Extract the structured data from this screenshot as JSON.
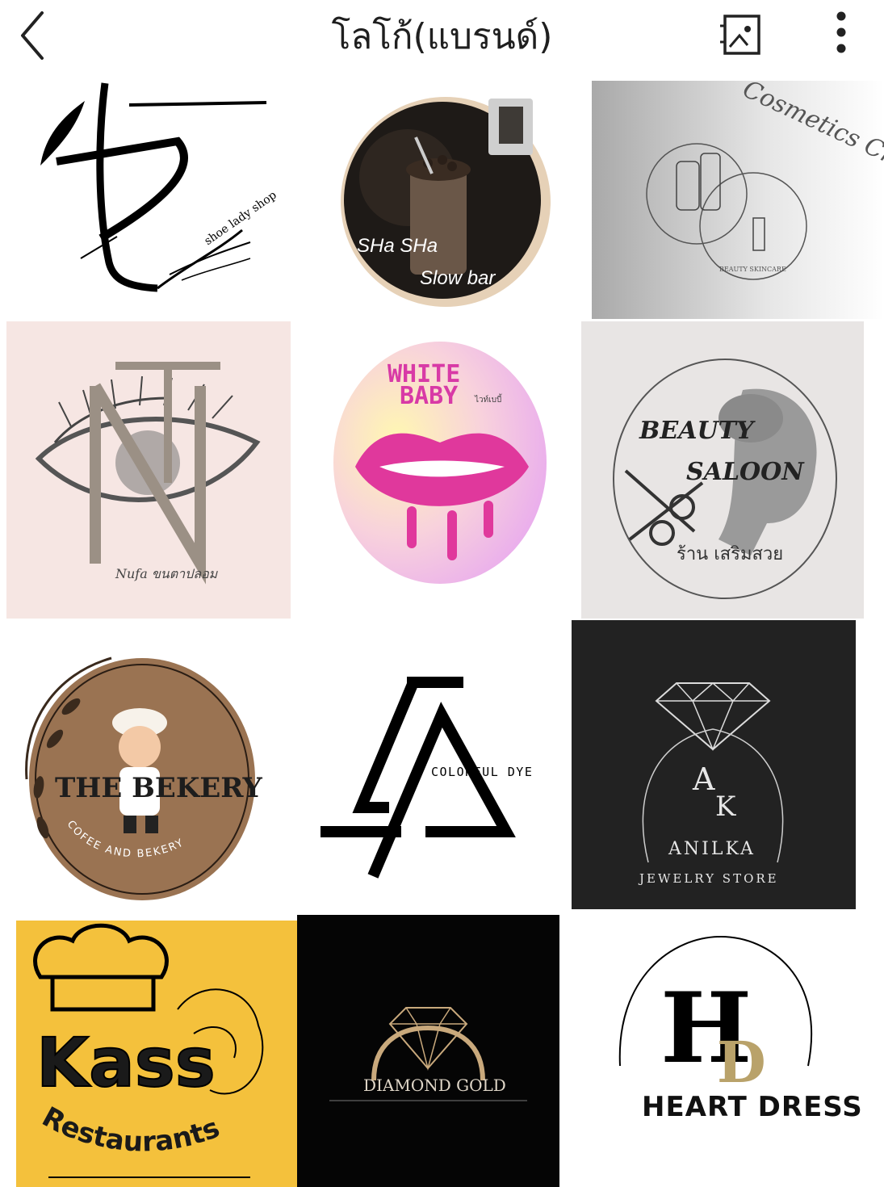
{
  "header": {
    "title": "โลโก้(แบรนด์)",
    "back_icon": "chevron-left-icon",
    "image_icon": "image-frame-icon",
    "more_icon": "more-vertical-icon"
  },
  "gallery": {
    "tiles": [
      {
        "texts": [
          "shoe lady shop"
        ]
      },
      {
        "texts": [
          "SHa SHa",
          "Slow bar"
        ]
      },
      {
        "texts": [
          "Cosmetics Chic",
          "BEAUTY SKINCARE"
        ]
      },
      {
        "texts": [
          "Nufa ขนตาปลอม"
        ]
      },
      {
        "texts": [
          "WHITE",
          "BABY",
          "ไวท์เบบี้"
        ]
      },
      {
        "texts": [
          "BEAUTY",
          "SALOON",
          "ร้าน เสริมสวย"
        ]
      },
      {
        "texts": [
          "THE BEKERY",
          "COFEE AND BEKERY"
        ]
      },
      {
        "texts": [
          "COLORFUL DYE"
        ]
      },
      {
        "texts": [
          "ANILKA",
          "JEWELRY STORE",
          "A",
          "K"
        ]
      },
      {
        "texts": [
          "Kass",
          "Restaurants"
        ]
      },
      {
        "texts": [
          "DIAMOND GOLD"
        ]
      },
      {
        "texts": [
          "HEART DRESS",
          "H",
          "D"
        ]
      }
    ]
  },
  "colors": {
    "kass_bg": "#f4c13c",
    "bakery_brown": "#9a7352",
    "dark_bg": "#222222",
    "black_bg": "#050505",
    "lips_pink": "#e0389c",
    "gold": "#b9a26a"
  }
}
